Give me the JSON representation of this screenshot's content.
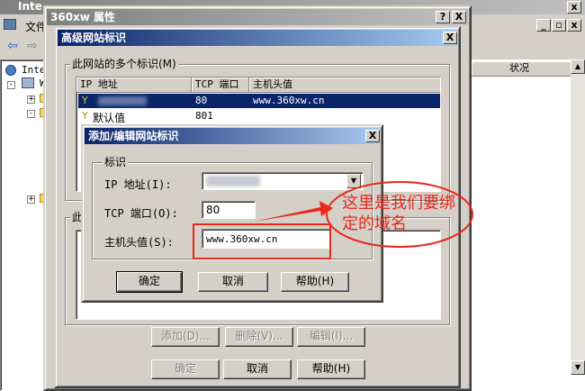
{
  "background_app": {
    "title_partial": "Inte",
    "menu_file": "文件",
    "tree_root": "Inte",
    "tree_child": "W",
    "status_column": "状况"
  },
  "props_window": {
    "title": "360xw 属性",
    "help_btn": "?",
    "close_btn": "X"
  },
  "adv_dialog": {
    "title": "高级网站标识",
    "group1_label": "此网站的多个标识(M)",
    "col_ip": "IP 地址",
    "col_port": "TCP 端口",
    "col_host": "主机头值",
    "rows": [
      {
        "ip": "",
        "port": "80",
        "host": "www.360xw.cn"
      },
      {
        "ip": "默认值",
        "port": "801",
        "host": ""
      }
    ],
    "group2_label": "此",
    "add_btn": "添加(D)...",
    "remove_btn": "删除(V)...",
    "edit_btn": "编辑(I)...",
    "ok_btn": "确定",
    "cancel_btn": "取消",
    "help_btn": "帮助(H)"
  },
  "edit_dialog": {
    "title": "添加/编辑网站标识",
    "group_label": "标识",
    "ip_label": "IP 地址(I):",
    "ip_value": "",
    "port_label": "TCP 端口(O):",
    "port_value": "80",
    "host_label": "主机头值(S):",
    "host_value": "www.360xw.cn",
    "ok_btn": "确定",
    "cancel_btn": "取消",
    "help_btn": "帮助(H)"
  },
  "annotation": {
    "text": "这里是我们要绑定的域名",
    "color": "#e8291c"
  },
  "colors": {
    "title_active": "#0a246a",
    "selection": "#0a246a",
    "face": "#d4d0c8"
  }
}
